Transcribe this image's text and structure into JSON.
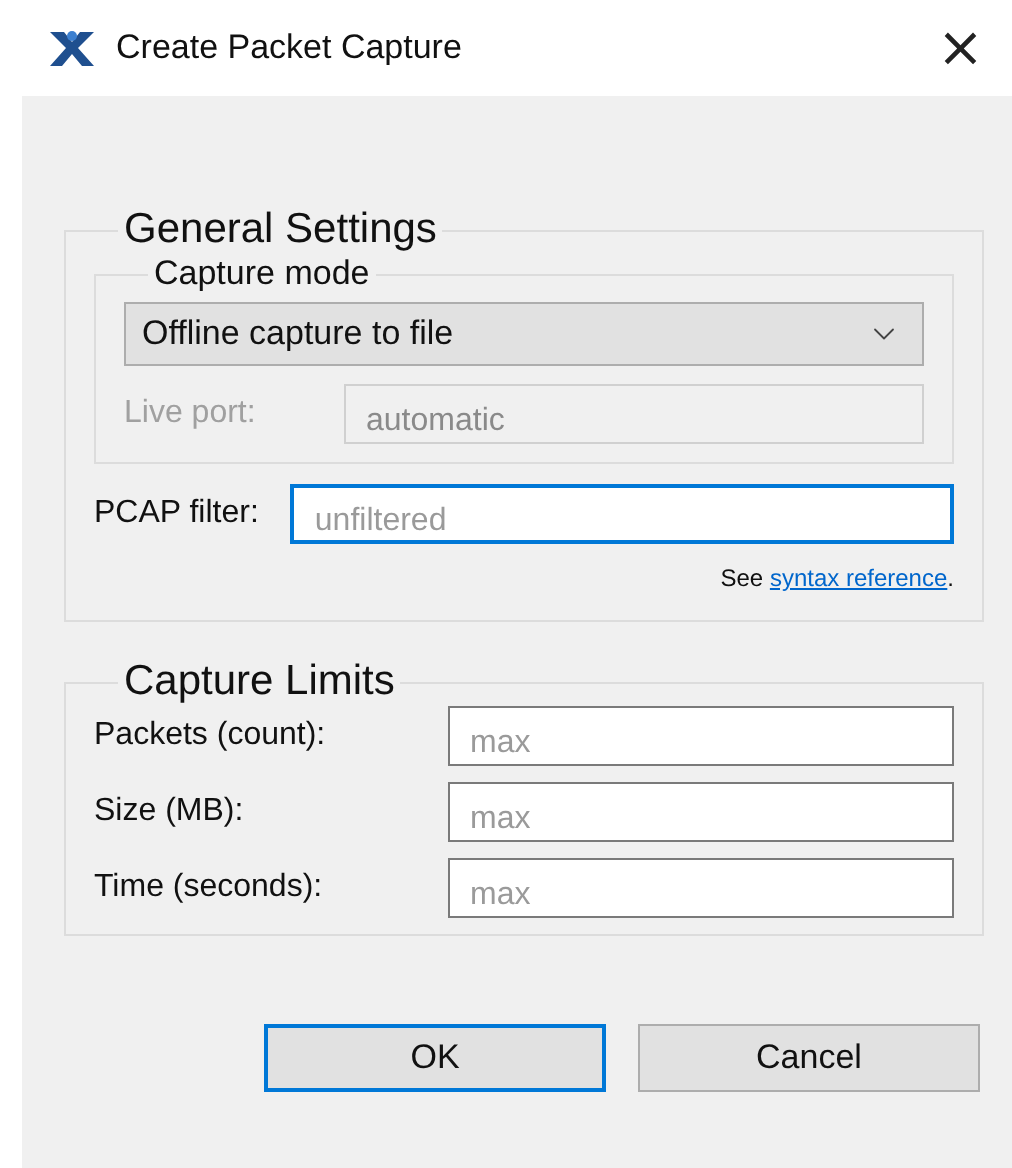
{
  "window": {
    "title": "Create Packet Capture",
    "close": "×"
  },
  "general_settings": {
    "title": "General Settings",
    "capture_mode": {
      "title": "Capture mode",
      "value": "Offline capture to file",
      "live_port": {
        "label": "Live port:",
        "placeholder": "automatic",
        "disabled": true
      }
    },
    "pcap_filter": {
      "label": "PCAP filter:",
      "placeholder": "unfiltered",
      "focused": true
    },
    "hint": {
      "text": "See",
      "link": "syntax reference",
      "end": "."
    }
  },
  "capture_limits": {
    "title": "Capture Limits",
    "fields": [
      {
        "label": "Packets (count):",
        "placeholder": "max"
      },
      {
        "label": "Size (MB):",
        "placeholder": "max"
      },
      {
        "label": "Time (seconds):",
        "placeholder": "max"
      }
    ]
  },
  "buttons": [
    {
      "label": "OK",
      "default": true
    },
    {
      "label": "Cancel",
      "default": false
    }
  ]
}
